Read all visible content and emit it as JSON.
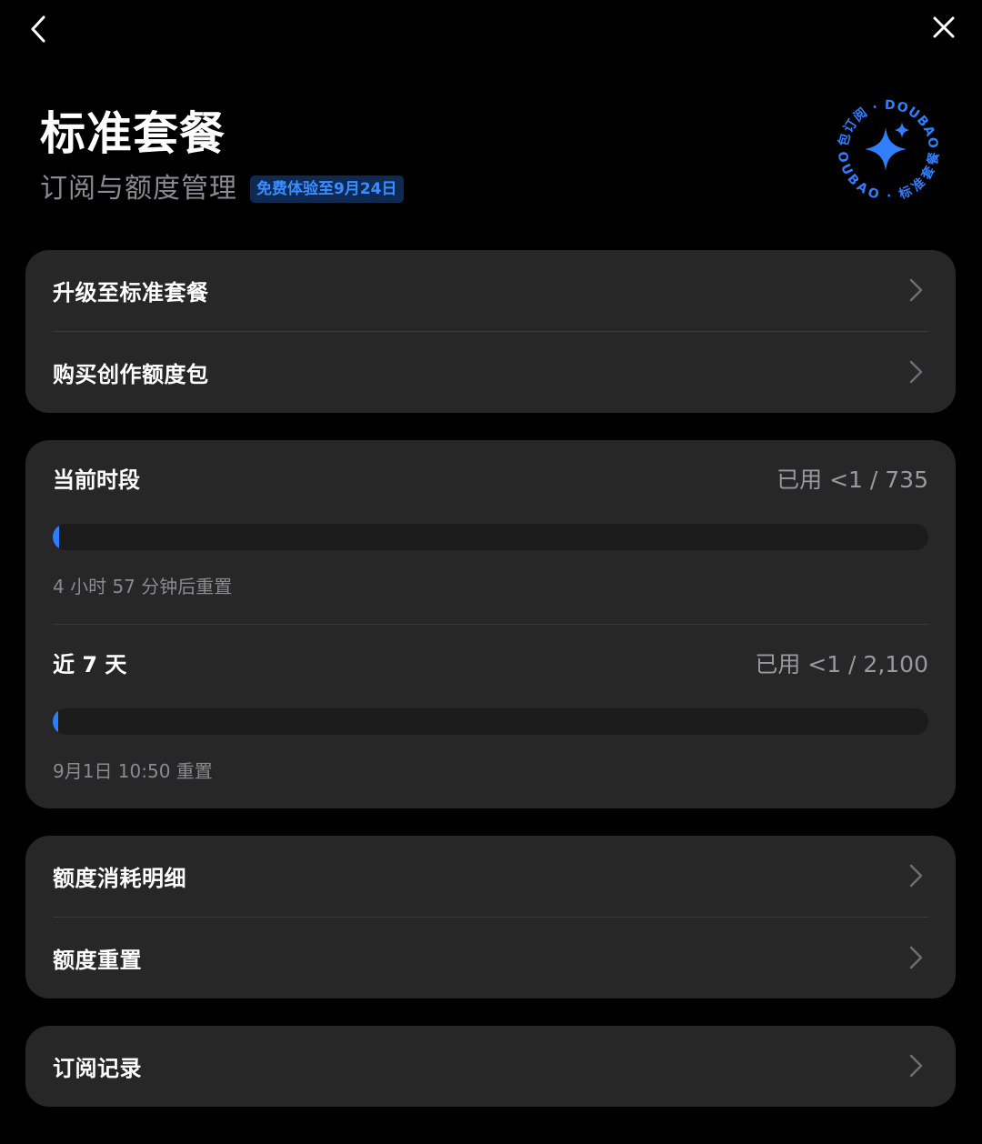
{
  "nav": {
    "back_icon": "chevron-left-icon",
    "close_icon": "close-icon"
  },
  "header": {
    "title": "标准套餐",
    "subtitle": "订阅与额度管理",
    "trial_badge": "免费体验至9月24日"
  },
  "seal": {
    "text_top": "豆包订阅 · DOUBAO ·",
    "text_bottom": "DOUBAO · 标准套餐 ·",
    "icon": "sparkle-icon"
  },
  "menu_top": [
    {
      "label": "升级至标准套餐"
    },
    {
      "label": "购买创作额度包"
    }
  ],
  "usage": [
    {
      "title": "当前时段",
      "value": "已用 <1 / 735",
      "progress_percent": 0.7,
      "note": "4 小时 57 分钟后重置"
    },
    {
      "title": "近 7 天",
      "value": "已用 <1 / 2,100",
      "progress_percent": 0.6,
      "note": "9月1日 10:50 重置"
    }
  ],
  "menu_mid": [
    {
      "label": "额度消耗明细"
    },
    {
      "label": "额度重置"
    }
  ],
  "menu_bottom": [
    {
      "label": "订阅记录"
    }
  ],
  "colors": {
    "accent": "#2b7fff",
    "badge_bg": "#0f2a52",
    "card_bg": "#272727",
    "background": "#000000"
  }
}
